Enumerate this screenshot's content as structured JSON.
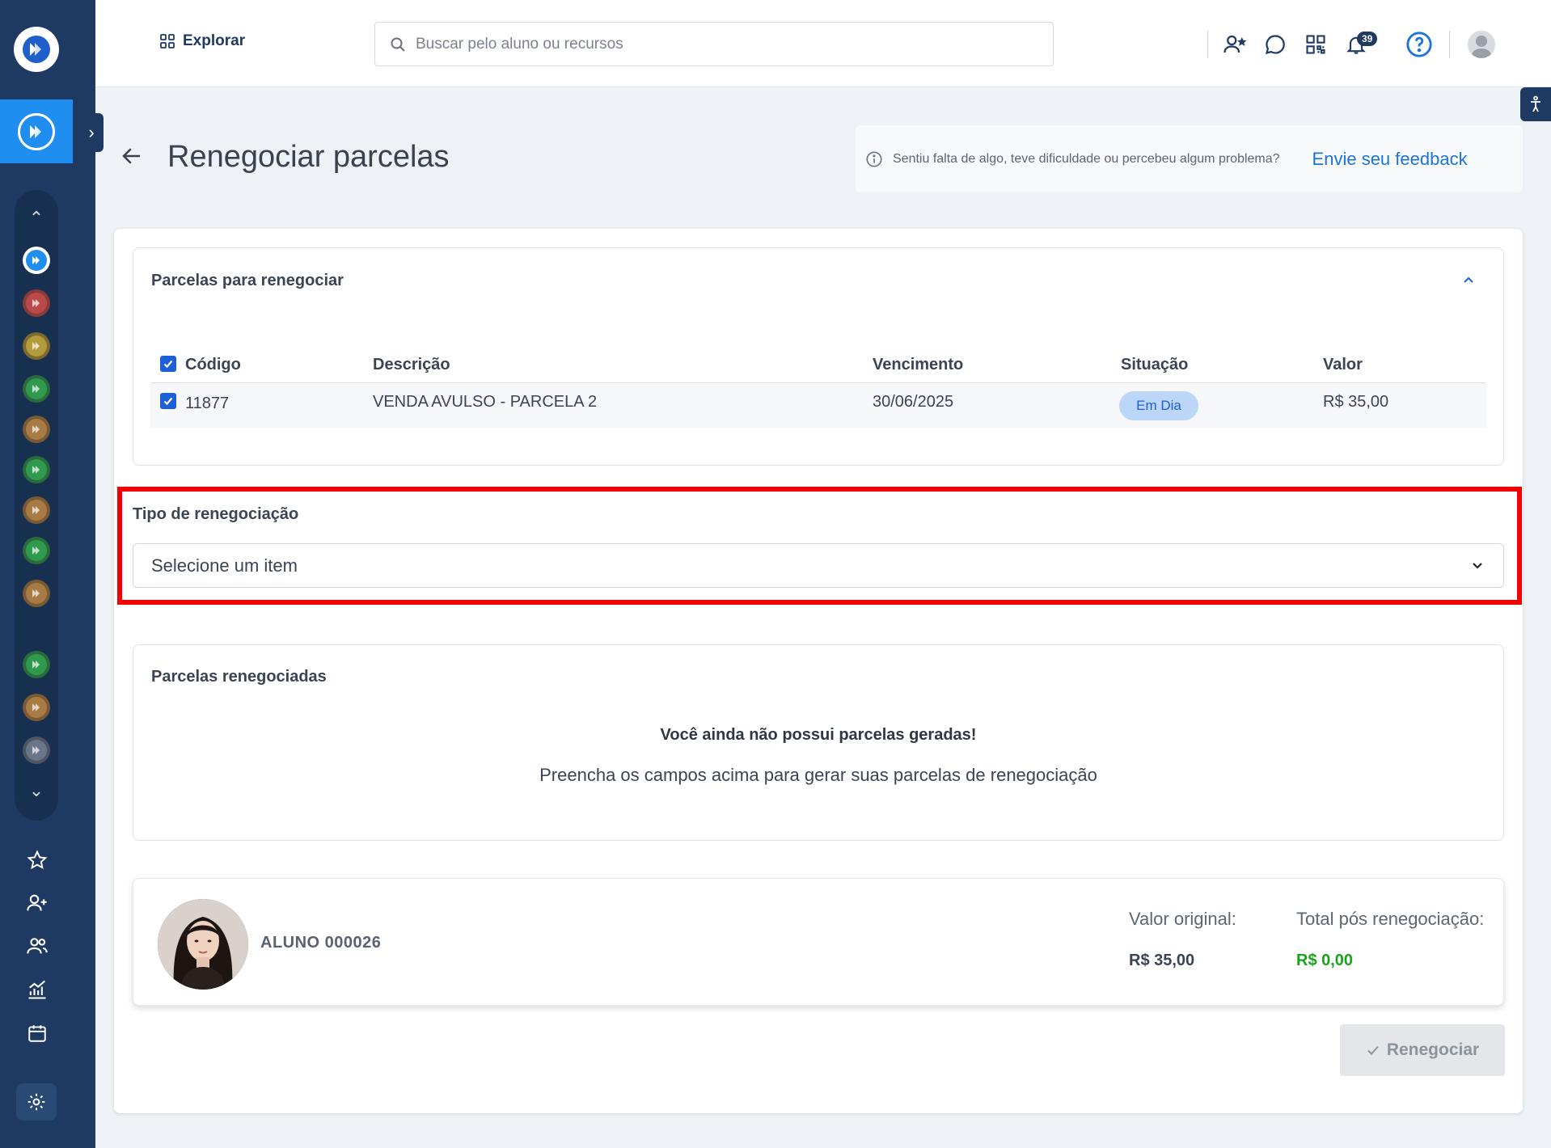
{
  "topbar": {
    "explore_label": "Explorar",
    "search_placeholder": "Buscar pelo aluno ou recursos",
    "notification_count": "39"
  },
  "page": {
    "title": "Renegociar parcelas",
    "feedback_text": "Sentiu falta de algo, teve dificuldade ou percebeu algum problema?",
    "feedback_link": "Envie seu feedback"
  },
  "installments_panel": {
    "title": "Parcelas para renegociar",
    "columns": [
      "Código",
      "Descrição",
      "Vencimento",
      "Situação",
      "Valor"
    ],
    "rows": [
      {
        "codigo": "11877",
        "descricao": "VENDA AVULSO - PARCELA 2",
        "vencimento": "30/06/2025",
        "situacao": "Em Dia",
        "valor": "R$ 35,00"
      }
    ]
  },
  "renegotiation_type": {
    "label": "Tipo de renegociação",
    "placeholder": "Selecione um item"
  },
  "renegotiated_panel": {
    "title": "Parcelas renegociadas",
    "empty_title": "Você ainda não possui parcelas geradas!",
    "empty_subtitle": "Preencha os campos acima para gerar suas parcelas de renegociação"
  },
  "student": {
    "name": "ALUNO 000026",
    "original_label": "Valor original:",
    "original_value": "R$ 35,00",
    "total_label": "Total pós renegociação:",
    "total_value": "R$ 0,00"
  },
  "actions": {
    "renegotiate_label": "Renegociar"
  },
  "colors": {
    "sidebar": "#1e3a63",
    "accent": "#1d74d8",
    "highlight": "#f40000",
    "total_green": "#1aa31a",
    "status_pill": "#bcd6f7"
  },
  "icons": {
    "sidebar_units": [
      "unit-logo-icon"
    ],
    "sidebar_nav": [
      "star-icon",
      "add-person-icon",
      "people-icon",
      "chart-icon",
      "calendar-icon",
      "gear-icon"
    ]
  }
}
